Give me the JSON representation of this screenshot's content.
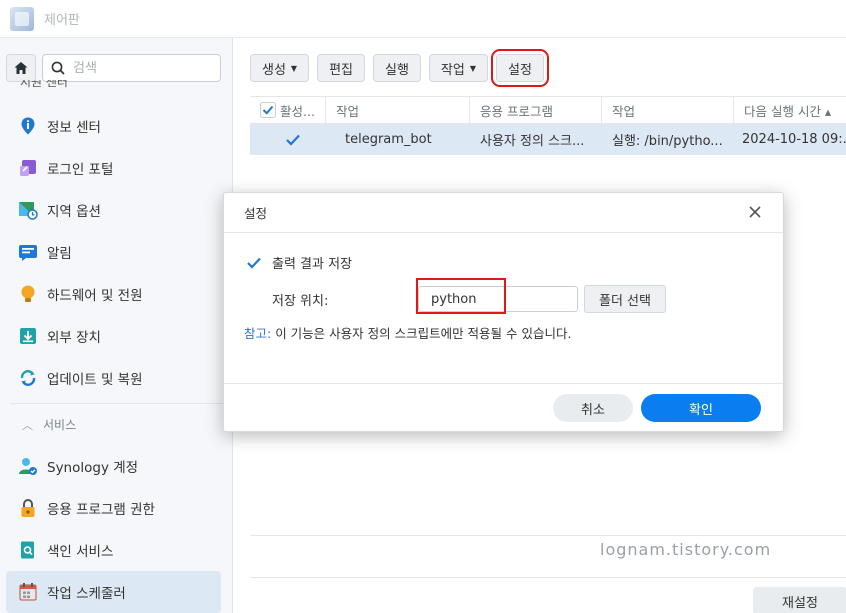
{
  "window": {
    "title": "제어판"
  },
  "sidebar": {
    "search_placeholder": "검색",
    "cut_item": "지원 센터",
    "items": [
      {
        "label": "정보 센터",
        "icon": "info-icon"
      },
      {
        "label": "로그인 포털",
        "icon": "login-portal-icon"
      },
      {
        "label": "지역 옵션",
        "icon": "regional-options-icon"
      },
      {
        "label": "알림",
        "icon": "notification-icon"
      },
      {
        "label": "하드웨어 및 전원",
        "icon": "hardware-power-icon"
      },
      {
        "label": "외부 장치",
        "icon": "external-device-icon"
      },
      {
        "label": "업데이트 및 복원",
        "icon": "update-restore-icon"
      }
    ],
    "section_label": "서비스",
    "service_items": [
      {
        "label": "Synology 계정",
        "icon": "synology-account-icon"
      },
      {
        "label": "응용 프로그램 권한",
        "icon": "app-permission-icon"
      },
      {
        "label": "색인 서비스",
        "icon": "index-service-icon"
      },
      {
        "label": "작업 스케줄러",
        "icon": "task-scheduler-icon"
      }
    ]
  },
  "toolbar": {
    "create": "생성",
    "edit": "편집",
    "run": "실행",
    "action": "작업",
    "settings": "설정"
  },
  "grid": {
    "headers": [
      "활성...",
      "작업",
      "응용 프로그램",
      "작업",
      "다음 실행 시간 ▴"
    ],
    "row": {
      "enabled": true,
      "task": "telegram_bot",
      "app": "사용자 정의 스크...",
      "action": "실행: /bin/pytho...",
      "next_run": "2024-10-18 09:..."
    }
  },
  "watermark": "lognam.tistory.com",
  "reset_button": "재설정",
  "dialog": {
    "title": "설정",
    "save_output_label": "출력 결과 저장",
    "save_output_checked": true,
    "location_label": "저장 위치:",
    "location_value": "python",
    "folder_button": "폴더 선택",
    "note_key": "참고:",
    "note_text": " 이 기능은 사용자 정의 스크립트에만 적용될 수 있습니다.",
    "cancel": "취소",
    "ok": "확인"
  },
  "colors": {
    "accent": "#0a7ef0",
    "highlight": "#e11818",
    "selected_row": "#dde8f5"
  }
}
